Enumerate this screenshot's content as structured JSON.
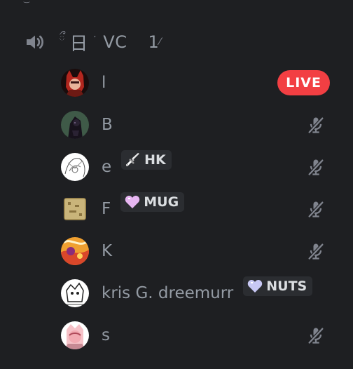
{
  "channel": {
    "name_prefix": "ྀ",
    "name_glyph": "日",
    "name_sep": "་",
    "name": "VC",
    "user_count": "1",
    "count_tail": "⁄"
  },
  "users": [
    {
      "name": "l",
      "live_label": "LIVE"
    },
    {
      "name": "B"
    },
    {
      "name": "e",
      "tag": "HK"
    },
    {
      "name": "F",
      "tag": "MUG"
    },
    {
      "name": "K"
    },
    {
      "name": "kris G. dreemurr",
      "tag": "NUTS"
    },
    {
      "name": "s"
    }
  ],
  "colors": {
    "background": "#1e1f22",
    "live": "#f23f43",
    "muted_icon": "#80848e",
    "tag_bg": "#2b2d31"
  }
}
